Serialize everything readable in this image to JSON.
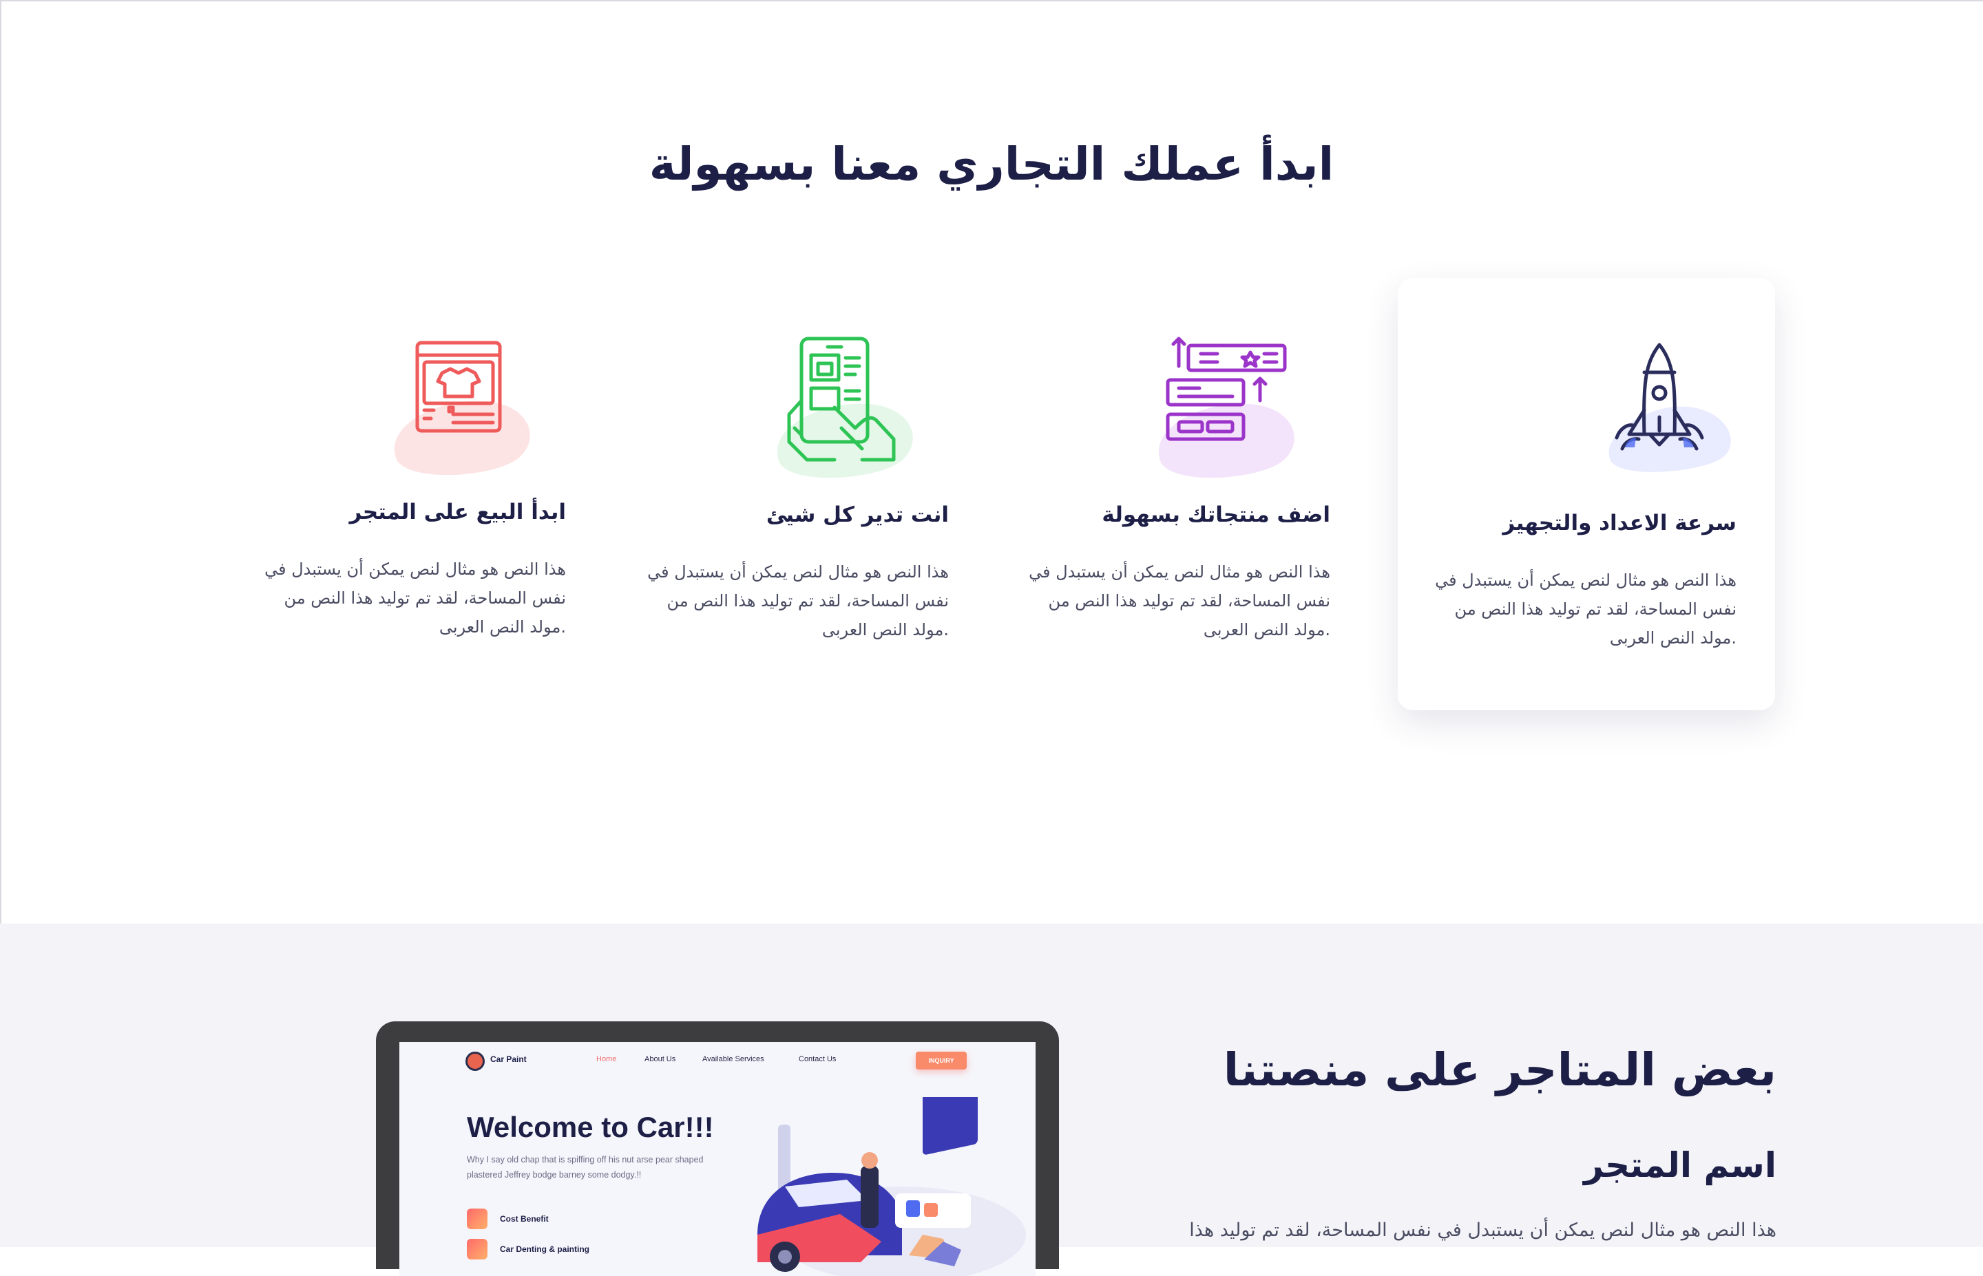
{
  "features": {
    "title": "ابدأ عملك التجاري معنا بسهولة",
    "cards": [
      {
        "title": "سرعة الاعداد والتجهيز",
        "line1": "هذا النص هو مثال لنص يمكن أن يستبدل في",
        "line2": "نفس المساحة، لقد تم توليد هذا النص من",
        "line3": ".مولد النص العربى",
        "icon": "rocket-icon",
        "color": "#2a2d5c"
      },
      {
        "title": "اضف منتجاتك بسهولة",
        "line1": "هذا النص هو مثال لنص يمكن أن يستبدل في",
        "line2": "نفس المساحة، لقد تم توليد هذا النص من",
        "line3": ".مولد النص العربى",
        "icon": "product-list-icon",
        "color": "#9b35c9"
      },
      {
        "title": "انت تدير كل شيئ",
        "line1": "هذا النص هو مثال لنص يمكن أن يستبدل في",
        "line2": "نفس المساحة، لقد تم توليد هذا النص من",
        "line3": ".مولد النص العربى",
        "icon": "tablet-hand-icon",
        "color": "#2ec455"
      },
      {
        "title": "ابدأ البيع على المتجر",
        "line1": "هذا النص هو مثال لنص يمكن أن يستبدل في",
        "line2": "نفس المساحة، لقد تم توليد هذا النص من",
        "line3": ".مولد النص العربى",
        "icon": "online-store-icon",
        "color": "#ef5a5a"
      }
    ]
  },
  "stores": {
    "title": "بعض المتاجر على منصتنا",
    "store_name": "اسم المتجر",
    "store_desc": "هذا النص هو مثال لنص يمكن أن يستبدل في نفس المساحة، لقد تم توليد هذا"
  },
  "preview": {
    "brand": "Car Paint",
    "nav": [
      "Home",
      "About Us",
      "Available Services",
      "Contact Us"
    ],
    "cta": "INQUIRY",
    "hero_title": "Welcome to Car!!!",
    "hero_sub": "Why I say old chap that is spiffing off his nut arse pear shaped plastered Jeffrey bodge barney some dodgy.!!",
    "features": [
      "Cost Benefit",
      "Car Denting & painting"
    ],
    "accent": "#f46c6c"
  }
}
